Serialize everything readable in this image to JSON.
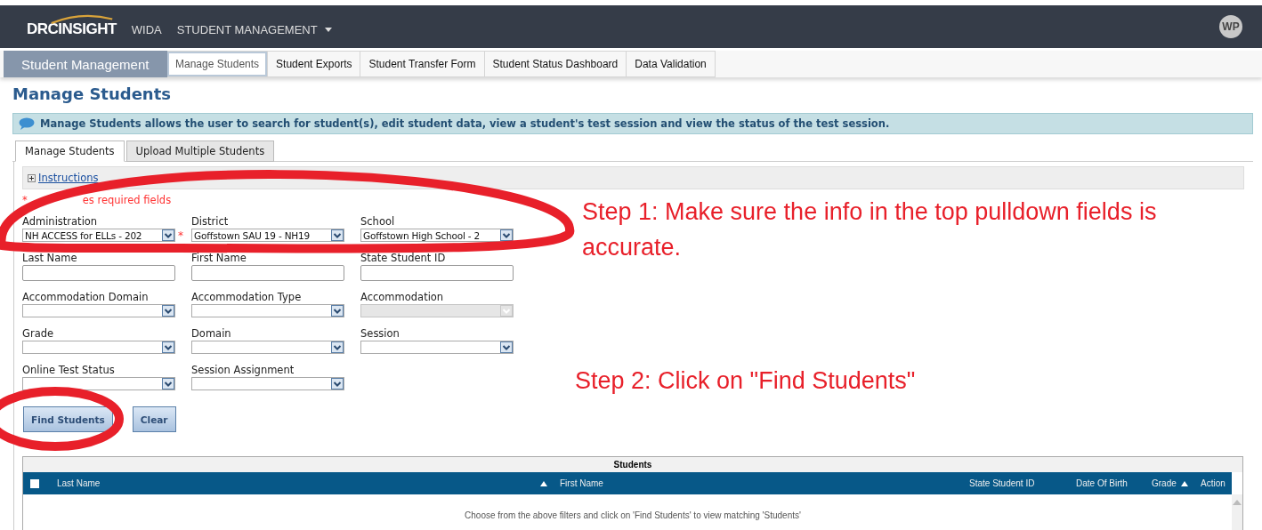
{
  "topbar": {
    "logo_left": "DRC",
    "logo_right": "INSIGHT",
    "brand": "WIDA",
    "menu": "STUDENT MANAGEMENT",
    "avatar": "WP"
  },
  "subnav": {
    "section": "Student Management",
    "tabs": [
      {
        "label": "Manage Students",
        "selected": true
      },
      {
        "label": "Student Exports",
        "selected": false
      },
      {
        "label": "Student Transfer Form",
        "selected": false
      },
      {
        "label": "Student Status Dashboard",
        "selected": false
      },
      {
        "label": "Data Validation",
        "selected": false
      }
    ]
  },
  "page_title": "Manage Students",
  "info": "Manage Students allows the user to search for student(s), edit student data, view a student's test session and view the status of the test session.",
  "form_tabs": [
    {
      "label": "Manage Students",
      "selected": true
    },
    {
      "label": "Upload Multiple Students",
      "selected": false
    }
  ],
  "instructions": {
    "label": "Instructions",
    "expanded": false
  },
  "required_note": {
    "mark": "*",
    "text": "es required fields"
  },
  "fields": [
    {
      "kind": "select",
      "label": "Administration",
      "value": "NH ACCESS for ELLs - 202",
      "required_mark": "*",
      "disabled": false
    },
    {
      "kind": "select",
      "label": "District",
      "value": "Goffstown SAU 19 - NH19",
      "disabled": false
    },
    {
      "kind": "select",
      "label": "School",
      "value": "Goffstown High School - 2",
      "disabled": false
    },
    {
      "kind": "text",
      "label": "Last Name"
    },
    {
      "kind": "text",
      "label": "First Name"
    },
    {
      "kind": "text",
      "label": "State Student ID"
    },
    {
      "kind": "select",
      "label": "Accommodation Domain",
      "disabled": false
    },
    {
      "kind": "select",
      "label": "Accommodation Type",
      "disabled": false
    },
    {
      "kind": "select",
      "label": "Accommodation",
      "disabled": true
    },
    {
      "kind": "select",
      "label": "Grade",
      "disabled": false
    },
    {
      "kind": "select",
      "label": "Domain",
      "disabled": false
    },
    {
      "kind": "select",
      "label": "Session",
      "disabled": false
    },
    {
      "kind": "select",
      "label": "Online Test Status",
      "disabled": false
    },
    {
      "kind": "select",
      "label": "Session Assignment",
      "disabled": false
    }
  ],
  "buttons": [
    "Find Students",
    "Clear"
  ],
  "table": {
    "title": "Students",
    "select_all": {
      "checked": false
    },
    "columns": [
      {
        "label": "Last Name",
        "sorted": true
      },
      {
        "label": "First Name",
        "sorted": false
      },
      {
        "label": "State Student ID",
        "sorted": false
      },
      {
        "label": "Date Of Birth",
        "sorted": false
      },
      {
        "label": "Grade",
        "sorted": true
      },
      {
        "label": "Action",
        "sorted": false
      }
    ],
    "empty_message": "Choose from the above filters and click on 'Find Students' to view matching 'Students'"
  },
  "annotations": [
    {
      "kind": "note",
      "text": "Step 1: Make sure the info in the top pulldown fields is accurate."
    },
    {
      "kind": "note",
      "text": "Step 2: Click on \"Find Students\""
    },
    {
      "kind": "ellipse"
    },
    {
      "kind": "ellipse"
    }
  ]
}
